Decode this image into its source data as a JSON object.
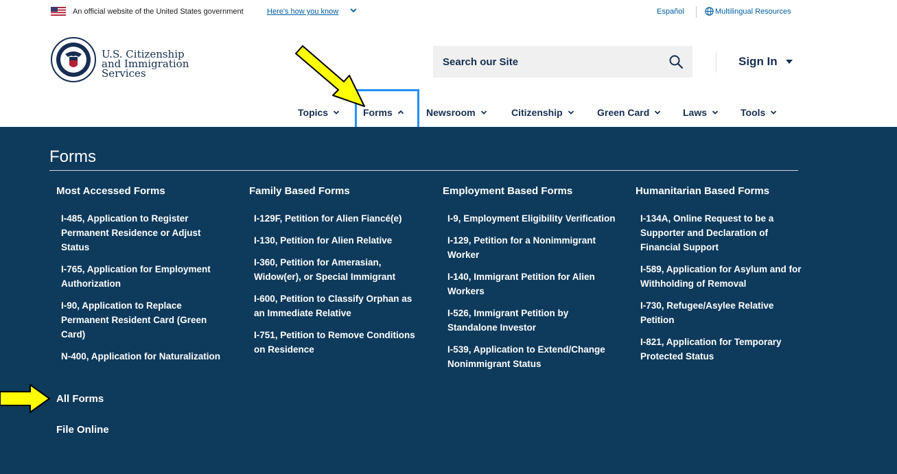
{
  "gov_banner": {
    "official_text": "An official website of the United States government",
    "how_you_know": "Here's how you know",
    "espanol": "Español",
    "multilingual": "Multilingual Resources"
  },
  "header": {
    "agency_line1": "U.S. Citizenship",
    "agency_line2": "and Immigration",
    "agency_line3": "Services",
    "search_placeholder": "Search our Site",
    "sign_in": "Sign In"
  },
  "nav": {
    "items": [
      {
        "label": "Topics",
        "expanded": false
      },
      {
        "label": "Forms",
        "expanded": true
      },
      {
        "label": "Newsroom",
        "expanded": false
      },
      {
        "label": "Citizenship",
        "expanded": false
      },
      {
        "label": "Green Card",
        "expanded": false
      },
      {
        "label": "Laws",
        "expanded": false
      },
      {
        "label": "Tools",
        "expanded": false
      }
    ]
  },
  "mega_menu": {
    "title": "Forms",
    "columns": [
      {
        "heading": "Most Accessed Forms",
        "links": [
          "I-485, Application to Register Permanent Residence or Adjust Status",
          "I-765, Application for Employment Authorization",
          "I-90, Application to Replace Permanent Resident Card (Green Card)",
          "N-400, Application for Naturalization"
        ]
      },
      {
        "heading": "Family Based Forms",
        "links": [
          "I-129F, Petition for Alien Fiancé(e)",
          "I-130, Petition for Alien Relative",
          "I-360, Petition for Amerasian, Widow(er), or Special Immigrant",
          "I-600, Petition to Classify Orphan as an Immediate Relative",
          "I-751, Petition to Remove Conditions on Residence"
        ]
      },
      {
        "heading": "Employment Based Forms",
        "links": [
          "I-9, Employment Eligibility Verification",
          "I-129, Petition for a Nonimmigrant Worker",
          "I-140, Immigrant Petition for Alien Workers",
          "I-526, Immigrant Petition by Standalone Investor",
          "I-539, Application to Extend/Change Nonimmigrant Status"
        ]
      },
      {
        "heading": "Humanitarian Based Forms",
        "links": [
          "I-134A, Online Request to be a Supporter and Declaration of Financial Support",
          "I-589, Application for Asylum and for Withholding of Removal",
          "I-730, Refugee/Asylee Relative Petition",
          "I-821, Application for Temporary Protected Status"
        ]
      }
    ],
    "all_forms": "All Forms",
    "file_online": "File Online"
  },
  "colors": {
    "mega_bg": "#0e3a5c",
    "brand_navy": "#162e51",
    "link_blue": "#005ea2",
    "focus_outline": "#2491ff",
    "annotation_arrow": "#ffff00"
  },
  "icons": [
    "us-flag-icon",
    "chevron-down-icon",
    "globe-icon",
    "dhs-seal-icon",
    "search-icon",
    "caret-down-icon",
    "chevron-up-icon",
    "annotation-arrow-icon"
  ]
}
